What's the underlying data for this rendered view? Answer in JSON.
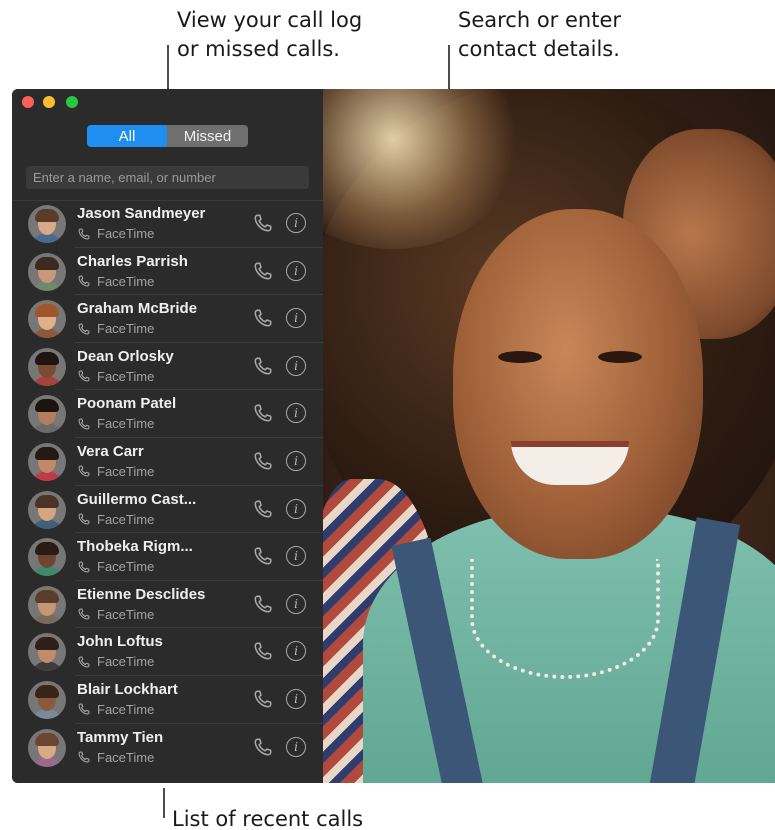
{
  "callouts": {
    "call_log": {
      "line1": "View your call log",
      "line2": "or missed calls."
    },
    "search": {
      "line1": "Search or enter",
      "line2": "contact details."
    },
    "recent": {
      "text": "List of recent calls"
    }
  },
  "segmented": {
    "all_label": "All",
    "missed_label": "Missed",
    "selected": "All"
  },
  "search": {
    "placeholder": "Enter a name, email, or number",
    "value": ""
  },
  "colors": {
    "accent": "#1e8ff0",
    "sidebar_bg": "#2b2b2b",
    "close": "#fe5f57",
    "minimize": "#febc2e",
    "maximize": "#28c840"
  },
  "calls": [
    {
      "name": "Jason Sandmeyer",
      "type": "FaceTime",
      "call_icon": "phone-icon",
      "info_icon": "info-icon"
    },
    {
      "name": "Charles Parrish",
      "type": "FaceTime",
      "call_icon": "phone-icon",
      "info_icon": "info-icon"
    },
    {
      "name": "Graham McBride",
      "type": "FaceTime",
      "call_icon": "phone-icon",
      "info_icon": "info-icon"
    },
    {
      "name": "Dean Orlosky",
      "type": "FaceTime",
      "call_icon": "phone-icon",
      "info_icon": "info-icon"
    },
    {
      "name": "Poonam Patel",
      "type": "FaceTime",
      "call_icon": "phone-icon",
      "info_icon": "info-icon"
    },
    {
      "name": "Vera Carr",
      "type": "FaceTime",
      "call_icon": "phone-icon",
      "info_icon": "info-icon"
    },
    {
      "name": "Guillermo Cast...",
      "type": "FaceTime",
      "call_icon": "phone-icon",
      "info_icon": "info-icon"
    },
    {
      "name": "Thobeka Rigm...",
      "type": "FaceTime",
      "call_icon": "phone-icon",
      "info_icon": "info-icon"
    },
    {
      "name": "Etienne Desclides",
      "type": "FaceTime",
      "call_icon": "phone-icon",
      "info_icon": "info-icon"
    },
    {
      "name": "John Loftus",
      "type": "FaceTime",
      "call_icon": "phone-icon",
      "info_icon": "info-icon"
    },
    {
      "name": "Blair Lockhart",
      "type": "FaceTime",
      "call_icon": "phone-icon",
      "info_icon": "info-icon"
    },
    {
      "name": "Tammy Tien",
      "type": "FaceTime",
      "call_icon": "phone-icon",
      "info_icon": "info-icon"
    }
  ],
  "info_glyph": "i"
}
